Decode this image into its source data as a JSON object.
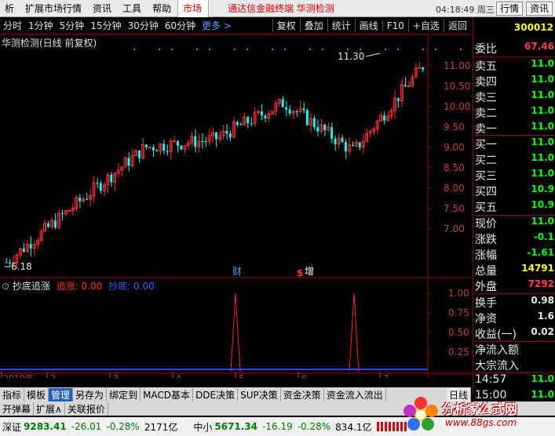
{
  "menu": {
    "items": [
      "析",
      "扩展市场行情",
      "资讯",
      "工具",
      "帮助"
    ],
    "active": "市场",
    "title": "通达信金融终端  华测检测",
    "clock": "04:18:49 周三",
    "btn_quote": "行情",
    "btn_info": "资讯"
  },
  "toolbar": {
    "periods": [
      "分时",
      "1分钟",
      "5分钟",
      "15分钟",
      "30分钟",
      "60分钟"
    ],
    "more": "更多 >",
    "tools": [
      "复权",
      "叠加",
      "统计",
      "画线",
      "F10",
      "+自选",
      "返回"
    ]
  },
  "chart": {
    "title": "华测检测(日线 前复权)",
    "high_label": "11.30",
    "low_label": "6.18",
    "markers": [
      "财",
      "$",
      "增"
    ],
    "indicator_name": "抄底追涨",
    "ind_up_label": "追涨:",
    "ind_up_value": "0.00",
    "ind_down_label": "抄底:",
    "ind_down_value": "0.00",
    "x_labels": [
      "2019年",
      "2",
      "3",
      "4",
      "5",
      "6",
      "7"
    ],
    "y_labels": [
      "11.00",
      "10.50",
      "10.00",
      "9.50",
      "9.00",
      "8.50",
      "8.00",
      "7.50",
      "7.00"
    ],
    "ind_y_labels": [
      "1.00",
      "0.75",
      "0.50",
      "0.25"
    ],
    "period_label": "日线"
  },
  "chart_data": {
    "type": "line",
    "title": "华测检测(日线 前复权)",
    "xlabel": "",
    "ylabel": "",
    "x": [
      "2019-01",
      "2019-02",
      "2019-03",
      "2019-04",
      "2019-05",
      "2019-06",
      "2019-07"
    ],
    "series": [
      {
        "values": [
          6.18,
          7.6,
          9.0,
          9.2,
          10.1,
          8.9,
          11.0
        ]
      }
    ],
    "ylim": [
      6.0,
      11.5
    ],
    "indicator": {
      "name": "抄底追涨",
      "spikes_x": [
        "2019-05",
        "2019-06"
      ],
      "spike_value": 1.0
    }
  },
  "panel": {
    "code": "300012",
    "rows": [
      {
        "label": "委比",
        "value": "67.46",
        "color": "#ff4040"
      },
      {
        "label": "卖五",
        "value": "11.0"
      },
      {
        "label": "卖四",
        "value": "11.0"
      },
      {
        "label": "卖三",
        "value": "11.0"
      },
      {
        "label": "卖二",
        "value": "11.0"
      },
      {
        "label": "卖一",
        "value": "11.0"
      },
      {
        "label": "买一",
        "value": "11.0"
      },
      {
        "label": "买二",
        "value": "11.0"
      },
      {
        "label": "买三",
        "value": "11.0"
      },
      {
        "label": "买四",
        "value": "10.9"
      },
      {
        "label": "买五",
        "value": "10.9"
      },
      {
        "label": "现价",
        "value": "11.0"
      },
      {
        "label": "涨跌",
        "value": "-0.1"
      },
      {
        "label": "涨幅",
        "value": "-1.61"
      },
      {
        "label": "总量",
        "value": "14791",
        "color": "#ffff00"
      },
      {
        "label": "外盘",
        "value": "7292",
        "color": "#ff4040"
      },
      {
        "label": "换手",
        "value": "0.98",
        "color": "#e8e8e8"
      },
      {
        "label": "净资",
        "value": "1.6",
        "color": "#e8e8e8"
      },
      {
        "label": "收益(一)",
        "value": "0.02",
        "color": "#e8e8e8"
      },
      {
        "label": "净流入额",
        "value": ""
      },
      {
        "label": "大宗流入",
        "value": ""
      },
      {
        "label": "14:57",
        "value": "11.0"
      },
      {
        "label": "15:00",
        "value": "11.0"
      }
    ]
  },
  "tabs1": [
    "指标",
    "模板",
    "管理",
    "另存为",
    "绑定到",
    "MACD基本",
    "DDE决策",
    "SUP决策",
    "资金决策",
    "资金流入流出"
  ],
  "tabs1_active": "管理",
  "tabs2": [
    "开弹幕",
    "扩展∧",
    "关联报价"
  ],
  "status": {
    "sz_label": "深证",
    "sz_value": "9283.41",
    "sz_change": "-26.01",
    "sz_pct": "-0.28%",
    "sz_amount": "2171亿",
    "zx_label": "中小",
    "zx_value": "5671.34",
    "zx_change": "-16.19",
    "zx_pct": "-0.28%",
    "zx_amount": "834.1亿"
  },
  "brand": {
    "name": "分析家公式网",
    "url": "www.88gs.com"
  },
  "colors": {
    "up": "#ff3030",
    "down": "#00ffff",
    "axis": "#a00000",
    "price_green": "#00ff00"
  }
}
